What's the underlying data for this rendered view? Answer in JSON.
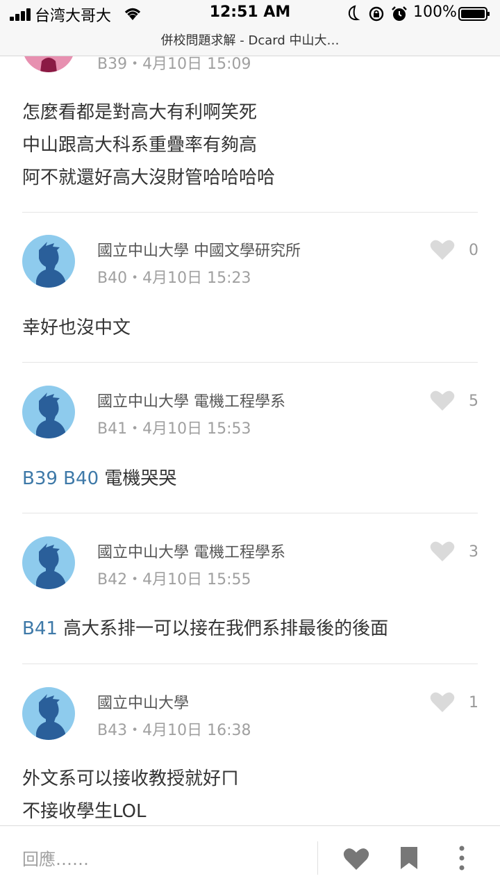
{
  "status_bar": {
    "carrier": "台湾大哥大",
    "time": "12:51 AM",
    "battery": "100%"
  },
  "url_bar": {
    "title": "併校問題求解 - Dcard 中山大…"
  },
  "partial_post": {
    "meta": "B39・4月10日 15:09",
    "lines": [
      "怎麼看都是對高大有利啊笑死",
      "中山跟高大科系重疊率有夠高",
      "阿不就還好高大沒財管哈哈哈哈"
    ]
  },
  "posts": [
    {
      "author": "國立中山大學 中國文學研究所",
      "meta": "B40・4月10日 15:23",
      "likes": "0",
      "body_text": "幸好也沒中文"
    },
    {
      "author": "國立中山大學 電機工程學系",
      "meta": "B41・4月10日 15:53",
      "likes": "5",
      "mentions": "B39 B40",
      "body_text": " 電機哭哭"
    },
    {
      "author": "國立中山大學 電機工程學系",
      "meta": "B42・4月10日 15:55",
      "likes": "3",
      "mentions": "B41",
      "body_text": " 高大系排一可以接在我們系排最後的後面"
    },
    {
      "author": "國立中山大學",
      "meta": "B43・4月10日 16:38",
      "likes": "1",
      "lines": [
        "外文系可以接收教授就好ㄇ",
        "不接收學生LOL"
      ]
    }
  ],
  "bottom_bar": {
    "reply_placeholder": "回應……",
    "icons": [
      "heart-icon",
      "bookmark-icon",
      "more-icon"
    ]
  },
  "colors": {
    "mention": "#3e79a8",
    "avatar_blue": "#8ecbed",
    "avatar_pink": "#e790b0",
    "icon_gray": "#dadada"
  }
}
